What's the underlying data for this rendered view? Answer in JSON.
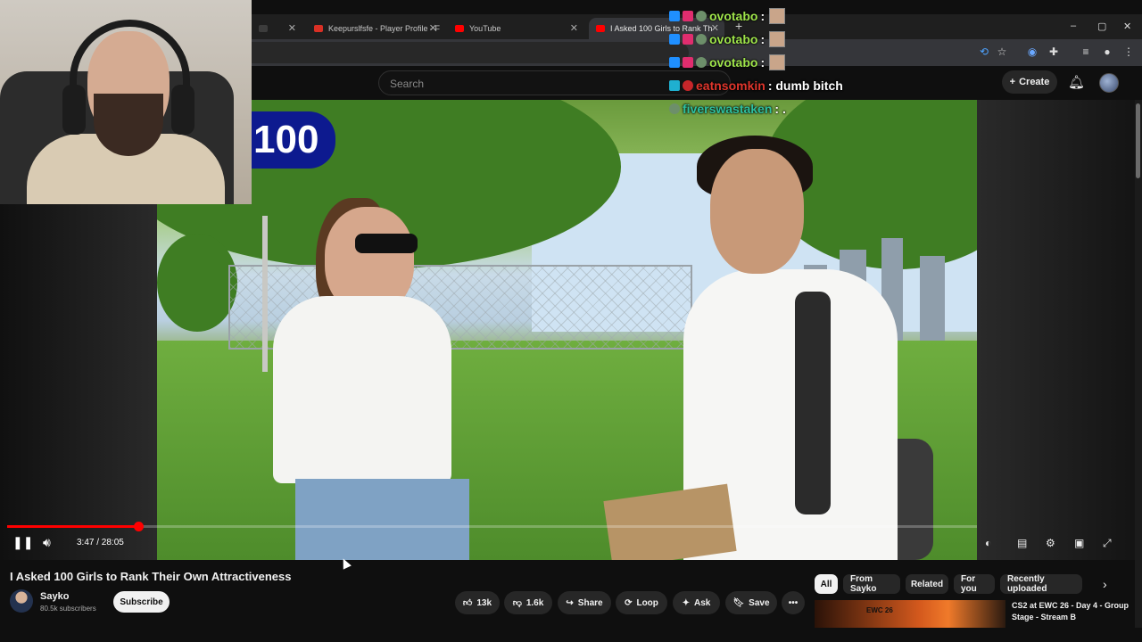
{
  "browser": {
    "tabs": [
      {
        "label": "",
        "favicon_color": "#3c3c3c"
      },
      {
        "label": "Keepurslfsfe - Player Profile - F",
        "favicon_color": "#d93025"
      },
      {
        "label": "YouTube",
        "favicon_color": "#ff0000"
      },
      {
        "label": "I Asked 100 Girls to Rank Th",
        "favicon_color": "#ff0000"
      }
    ],
    "new_tab": "+",
    "window_controls": [
      "–",
      "▢",
      "✕"
    ]
  },
  "youtube": {
    "search": {
      "placeholder": "Search"
    },
    "create_label": "Create",
    "video": {
      "overlay_text": "100",
      "current_time": "3:47",
      "duration": "28:05",
      "time_display": "3:47 / 28:05",
      "progress": 0.135
    },
    "title": "I Asked 100 Girls to Rank Their Own Attractiveness",
    "channel": {
      "name": "Sayko",
      "subscribers": "80.5k subscribers",
      "subscribe_label": "Subscribe"
    },
    "actions": {
      "likes": "13k",
      "dislikes": "1.6k",
      "share": "Share",
      "loop": "Loop",
      "ask": "Ask",
      "save": "Save",
      "more": "•••"
    },
    "chips": [
      {
        "label": "All",
        "active": true
      },
      {
        "label": "From Sayko",
        "active": false
      },
      {
        "label": "Related",
        "active": false
      },
      {
        "label": "For you",
        "active": false
      },
      {
        "label": "Recently uploaded",
        "active": false
      }
    ],
    "recommended": {
      "title": "CS2 at EWC 26 - Day 4 - Group Stage - Stream B",
      "thumb_text": "EWC 26"
    }
  },
  "chat": [
    {
      "user": "ovotabo",
      "message": "",
      "color": "#9ee34a"
    },
    {
      "user": "ovotabo",
      "message": "",
      "color": "#9ee34a"
    },
    {
      "user": "ovotabo",
      "message": "",
      "color": "#9ee34a"
    },
    {
      "user": "eatnsomkin",
      "message": ": dumb bitch",
      "color": "#e0362c"
    },
    {
      "user": "fiverswastaken",
      "message": ": .",
      "color": "#2ec1a0"
    }
  ],
  "colors": {
    "accent": "#ff0000",
    "background": "#0f0f0f",
    "chip_active": "#f1f1f1"
  }
}
